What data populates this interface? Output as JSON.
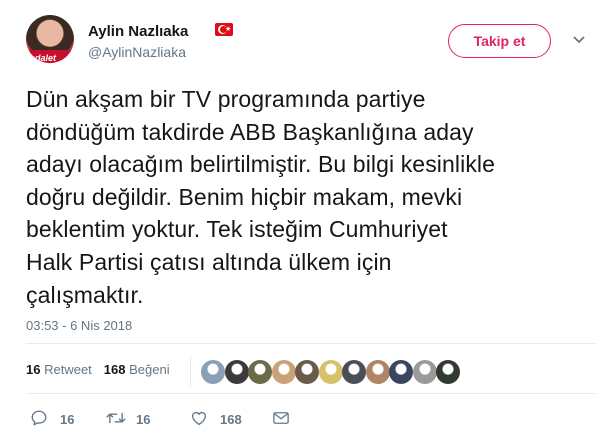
{
  "user": {
    "name": "Aylin Nazlıaka",
    "handle": "@AylinNazliaka",
    "avatar_text": "adalet",
    "flag_icon": "turkey-flag-icon"
  },
  "follow_button": {
    "label": "Takip et",
    "color": "#e0245e"
  },
  "menu_icon": "chevron-down-icon",
  "tweet": {
    "lines": [
      "Dün akşam bir TV programında partiye",
      "döndüğüm takdirde ABB Başkanlığına aday",
      "adayı olacağım belirtilmiştir. Bu bilgi kesinlikle",
      "doğru değildir. Benim hiçbir makam, mevki",
      "beklentim yoktur. Tek isteğim Cumhuriyet",
      "Halk Partisi çatısı altında ülkem için",
      "çalışmaktır."
    ],
    "timestamp": "03:53 - 6 Nis 2018"
  },
  "stats": {
    "retweet_count": "16",
    "retweet_label": "Retweet",
    "like_count": "168",
    "like_label": "Beğeni"
  },
  "likers": [
    {
      "color": "#8aa0b5"
    },
    {
      "color": "#3a3a3a"
    },
    {
      "color": "#6b6b4a"
    },
    {
      "color": "#c9a27a"
    },
    {
      "color": "#6a5a4a"
    },
    {
      "color": "#d7c26a"
    },
    {
      "color": "#4a4e58"
    },
    {
      "color": "#b08466"
    },
    {
      "color": "#3b4560"
    },
    {
      "color": "#9a9a9a"
    },
    {
      "color": "#2f3a32"
    }
  ],
  "actions": {
    "reply_count": "16",
    "retweet_count": "16",
    "like_count": "168"
  },
  "colors": {
    "text": "#14171a",
    "muted": "#657786",
    "divider": "#e6ecf0"
  }
}
